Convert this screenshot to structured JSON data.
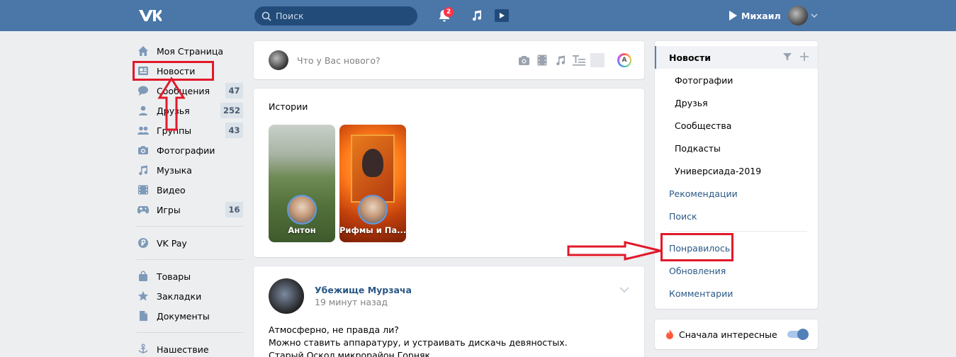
{
  "header": {
    "search_placeholder": "Поиск",
    "notifications_count": "2",
    "user_name": "Михаил"
  },
  "leftnav": {
    "items": [
      {
        "label": "Моя Страница",
        "icon": "home-icon"
      },
      {
        "label": "Новости",
        "icon": "news-icon"
      },
      {
        "label": "Сообщения",
        "icon": "messages-icon",
        "count": "47"
      },
      {
        "label": "Друзья",
        "icon": "friends-icon",
        "count": "252"
      },
      {
        "label": "Группы",
        "icon": "groups-icon",
        "count": "43"
      },
      {
        "label": "Фотографии",
        "icon": "camera-icon"
      },
      {
        "label": "Музыка",
        "icon": "music-icon"
      },
      {
        "label": "Видео",
        "icon": "video-icon"
      },
      {
        "label": "Игры",
        "icon": "gamepad-icon",
        "count": "16"
      }
    ],
    "vkpay": {
      "label": "VK Pay",
      "icon": "ruble-icon"
    },
    "group2": [
      {
        "label": "Товары",
        "icon": "bag-icon"
      },
      {
        "label": "Закладки",
        "icon": "star-icon"
      },
      {
        "label": "Документы",
        "icon": "document-icon"
      }
    ],
    "group3": [
      {
        "label": "Нашествие",
        "icon": "anchor-icon"
      }
    ]
  },
  "composer": {
    "placeholder": "Что у Вас нового?"
  },
  "stories": {
    "title": "Истории",
    "items": [
      {
        "name": "Антон"
      },
      {
        "name": "Рифмы и Па..."
      }
    ]
  },
  "post": {
    "author": "Убежище Мурзача",
    "time": "19 минут назад",
    "lines": [
      "Атмосферно, не правда ли?",
      "Можно ставить аппаратуру, и устраивать дискачь девяностых.",
      "Старый Оскол микрорайон Горняк"
    ]
  },
  "rightmenu": {
    "news": "Новости",
    "sub": [
      "Фотографии",
      "Друзья",
      "Сообщества",
      "Подкасты",
      "Универсиада-2019"
    ],
    "recommendations": "Рекомендации",
    "search": "Поиск",
    "liked": "Понравилось",
    "updates": "Обновления",
    "comments": "Комментарии"
  },
  "interesting": {
    "label": "Сначала интересные"
  },
  "colors": {
    "header": "#4a76a8",
    "link": "#2a5885",
    "annotation": "#e1192a",
    "background": "#edeef0"
  }
}
